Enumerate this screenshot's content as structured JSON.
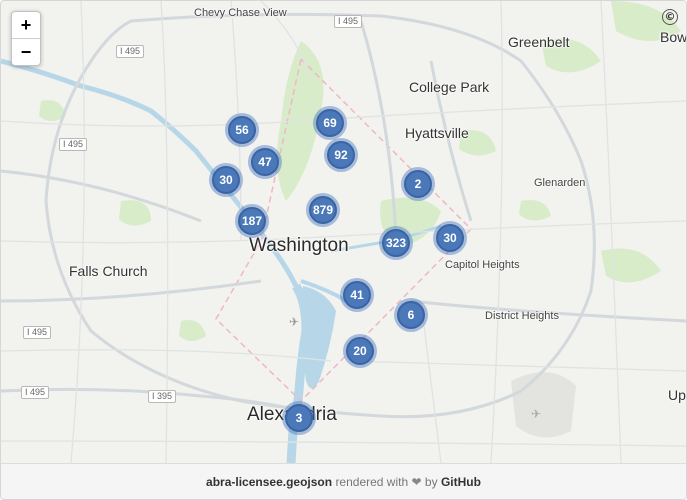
{
  "map": {
    "places": [
      {
        "name": "Chevy Chase View",
        "kind": "small"
      },
      {
        "name": "Greenbelt",
        "kind": "city"
      },
      {
        "name": "College Park",
        "kind": "city"
      },
      {
        "name": "Hyattsville",
        "kind": "city"
      },
      {
        "name": "Glenarden",
        "kind": "small"
      },
      {
        "name": "Capitol Heights",
        "kind": "small"
      },
      {
        "name": "District Heights",
        "kind": "small"
      },
      {
        "name": "Falls Church",
        "kind": "city"
      },
      {
        "name": "Washington",
        "kind": "big"
      },
      {
        "name": "Alexandria",
        "kind": "big"
      },
      {
        "name": "Bow",
        "kind": "city"
      },
      {
        "name": "Up",
        "kind": "city"
      }
    ],
    "shields": [
      "I 495",
      "I 495",
      "I 495",
      "I 495",
      "I 495",
      "I 395"
    ],
    "clusters": [
      {
        "count": "56",
        "color": "#4a78b8"
      },
      {
        "count": "69",
        "color": "#4a78b8"
      },
      {
        "count": "92",
        "color": "#4a78b8"
      },
      {
        "count": "47",
        "color": "#4a78b8"
      },
      {
        "count": "30",
        "color": "#4a78b8"
      },
      {
        "count": "2",
        "color": "#4a78b8"
      },
      {
        "count": "187",
        "color": "#4a78b8"
      },
      {
        "count": "879",
        "color": "#4a78b8"
      },
      {
        "count": "323",
        "color": "#4a78b8"
      },
      {
        "count": "30",
        "color": "#4a78b8"
      },
      {
        "count": "41",
        "color": "#4a78b8"
      },
      {
        "count": "6",
        "color": "#4a78b8"
      },
      {
        "count": "20",
        "color": "#4a78b8"
      },
      {
        "count": "3",
        "color": "#4a78b8"
      }
    ],
    "controls": {
      "zoom_in": "+",
      "zoom_out": "−",
      "attribution": "©"
    },
    "icons": {
      "airport_1": "airplane-icon",
      "airport_2": "airplane-icon"
    }
  },
  "footer": {
    "filename": "abra-licensee.geojson",
    "rendered_with": "rendered with",
    "heart": "❤",
    "by": "by",
    "brand": "GitHub"
  },
  "colors": {
    "cluster_fill": "#4a78b8",
    "water": "#b7d7e8",
    "park": "#d6ecc8",
    "land": "#f2f2ef"
  }
}
